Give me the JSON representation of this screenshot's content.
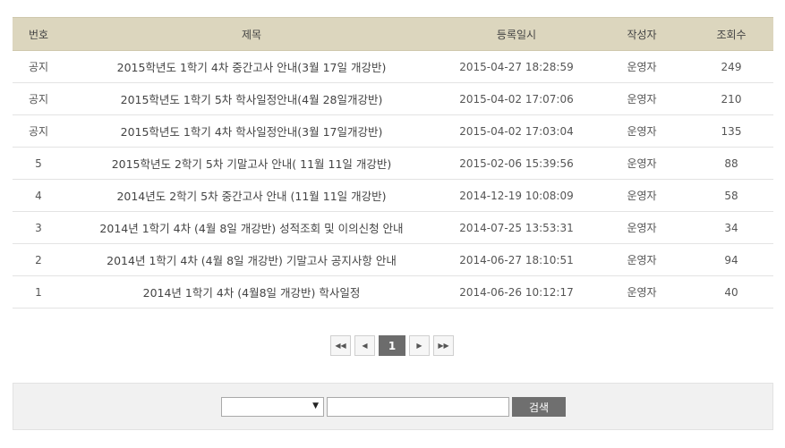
{
  "table": {
    "headers": {
      "num": "번호",
      "title": "제목",
      "date": "등록일시",
      "author": "작성자",
      "views": "조회수"
    },
    "rows": [
      {
        "num": "공지",
        "title": "2015학년도 1학기 4차 중간고사 안내(3월 17일 개강반)",
        "date": "2015-04-27 18:28:59",
        "author": "운영자",
        "views": "249"
      },
      {
        "num": "공지",
        "title": "2015학년도 1학기 5차 학사일정안내(4월 28일개강반)",
        "date": "2015-04-02 17:07:06",
        "author": "운영자",
        "views": "210"
      },
      {
        "num": "공지",
        "title": "2015학년도 1학기 4차 학사일정안내(3월 17일개강반)",
        "date": "2015-04-02 17:03:04",
        "author": "운영자",
        "views": "135"
      },
      {
        "num": "5",
        "title": "2015학년도 2학기 5차 기말고사 안내( 11월 11일 개강반)",
        "date": "2015-02-06 15:39:56",
        "author": "운영자",
        "views": "88"
      },
      {
        "num": "4",
        "title": "2014년도 2학기 5차 중간고사 안내 (11월 11일 개강반)",
        "date": "2014-12-19 10:08:09",
        "author": "운영자",
        "views": "58"
      },
      {
        "num": "3",
        "title": "2014년 1학기 4차 (4월 8일 개강반) 성적조회 및 이의신청 안내",
        "date": "2014-07-25 13:53:31",
        "author": "운영자",
        "views": "34"
      },
      {
        "num": "2",
        "title": "2014년 1학기 4차 (4월 8일 개강반) 기말고사 공지사항 안내",
        "date": "2014-06-27 18:10:51",
        "author": "운영자",
        "views": "94"
      },
      {
        "num": "1",
        "title": "2014년 1학기 4차 (4월8일 개강반) 학사일정",
        "date": "2014-06-26 10:12:17",
        "author": "운영자",
        "views": "40"
      }
    ]
  },
  "pagination": {
    "first": "◀◀",
    "prev": "◀",
    "current": "1",
    "next": "▶",
    "last": "▶▶"
  },
  "search": {
    "select_value": "",
    "select_arrow": "▼",
    "input_value": "",
    "button_label": "검색"
  },
  "colors": {
    "header_bg": "#dcd6be",
    "active_page": "#6c6c6c",
    "search_button": "#6f6f6f",
    "search_box_bg": "#f1f1f1"
  }
}
